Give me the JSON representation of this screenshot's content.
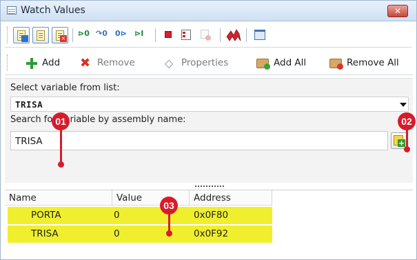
{
  "window": {
    "title": "Watch Values",
    "close_glyph": "✕"
  },
  "toolbar1": {
    "icons": [
      "watch-doc-blue-icon",
      "watch-doc-icon",
      "watch-doc-delete-icon",
      "step-into-icon",
      "step-over-icon",
      "step-out-icon",
      "run-to-cursor-icon",
      "breakpoint-icon",
      "breakpoint-list-icon",
      "clear-breakpoints-icon",
      "red-bolt-icon",
      "window-icon"
    ]
  },
  "toolbar2": {
    "add_label": "Add",
    "remove_label": "Remove",
    "properties_label": "Properties",
    "add_all_label": "Add All",
    "remove_all_label": "Remove All"
  },
  "variable_panel": {
    "select_label": "Select variable from list:",
    "select_value": "TRISA",
    "search_label": "Search for variable by assembly name:",
    "search_value": "TRISA"
  },
  "grid": {
    "columns": [
      "Name",
      "Value",
      "Address"
    ],
    "rows": [
      {
        "name": "PORTA",
        "value": "0",
        "address": "0x0F80"
      },
      {
        "name": "TRISA",
        "value": "0",
        "address": "0x0F92"
      }
    ],
    "highlight_color": "#f0ef2e"
  },
  "callouts": [
    "01",
    "02",
    "03"
  ],
  "colors": {
    "callout": "#d81b2b",
    "add_green": "#2f9b34",
    "remove_red": "#d33224"
  }
}
